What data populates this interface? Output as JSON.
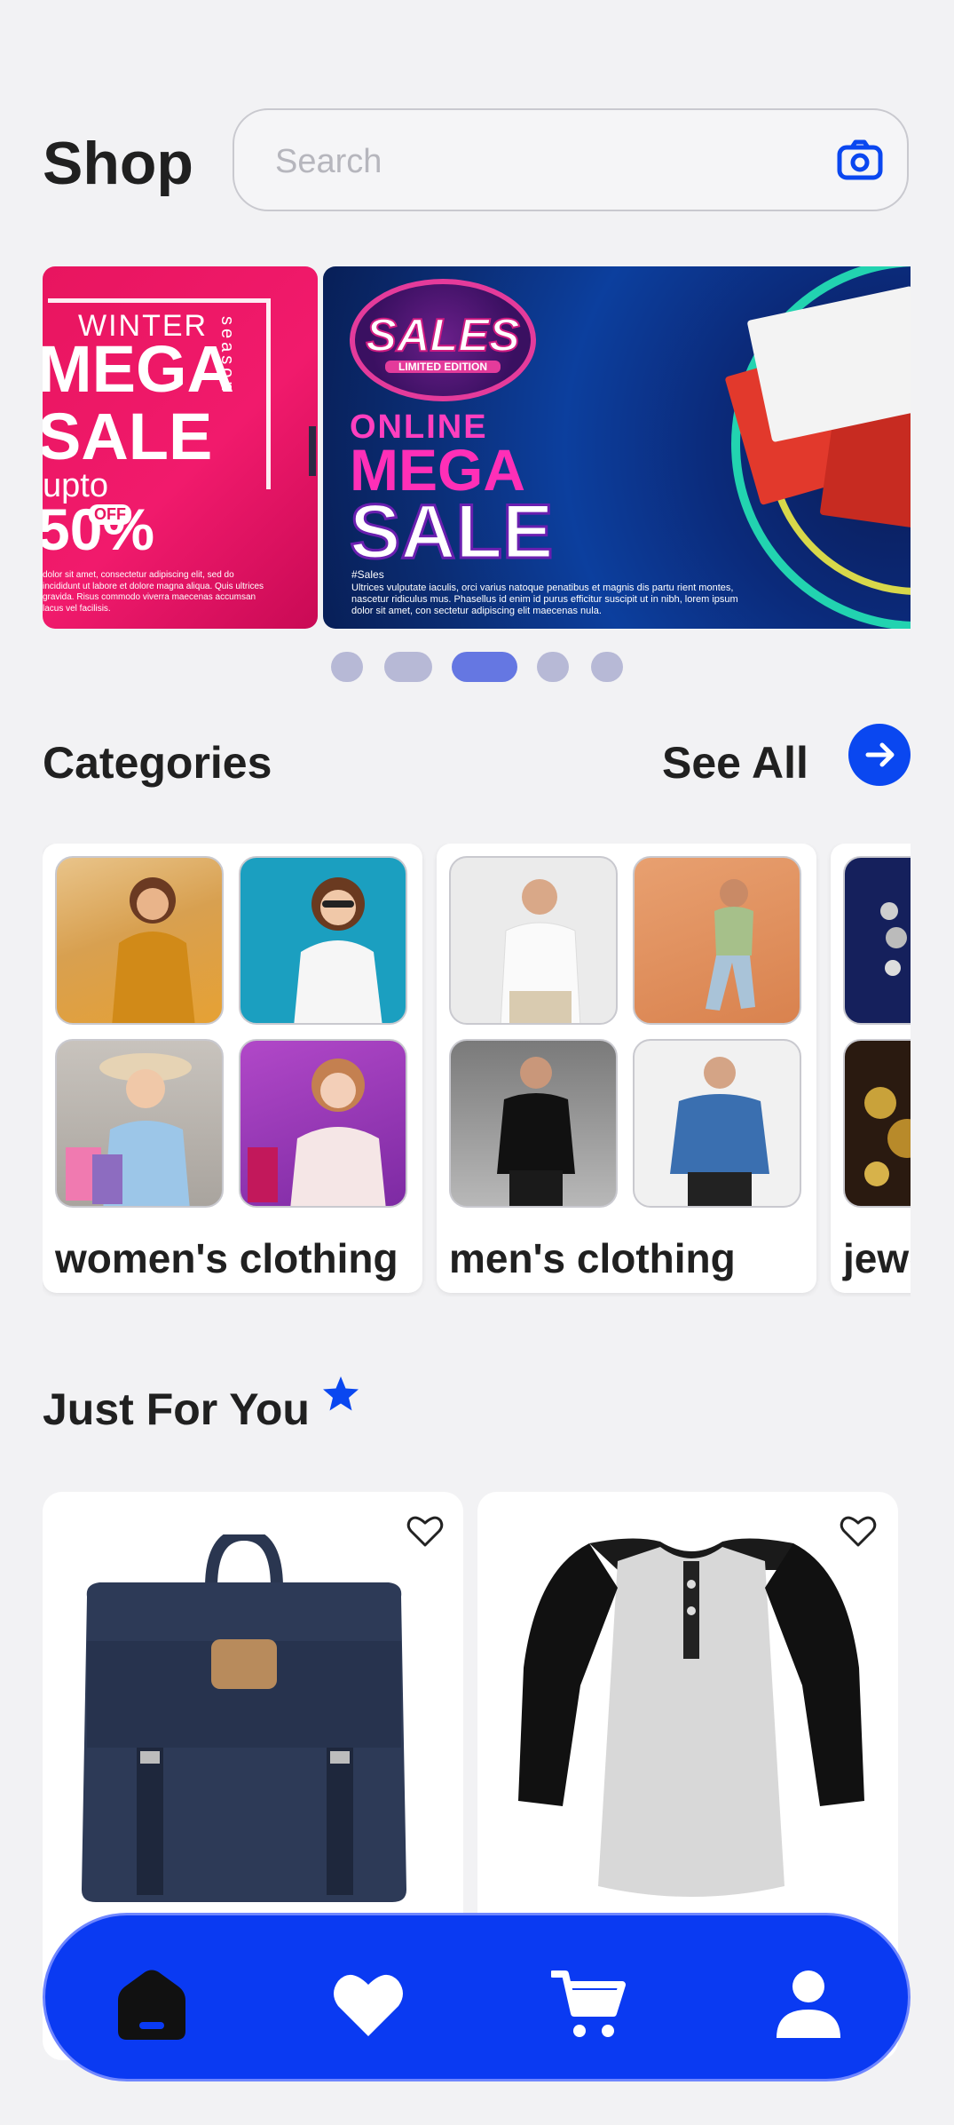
{
  "header": {
    "title": "Shop",
    "search_placeholder": "Search",
    "camera_icon": "camera-icon"
  },
  "banners": [
    {
      "id": "winter",
      "season": "season",
      "line1": "WINTER",
      "line2": "MEGA",
      "line3": "SALE",
      "line4": "upto",
      "discount": "50%",
      "off": "OFF",
      "fine_print": "dolor sit amet, consectetur adipiscing elit, sed do incididunt ut labore et dolore magna aliqua. Quis ultrices gravida. Risus commodo viverra maecenas accumsan lacus vel facilisis."
    },
    {
      "id": "online",
      "badge": "SALES",
      "badge_sub": "LIMITED EDITION",
      "line1": "ONLINE",
      "line2": "MEGA",
      "line3": "SALE",
      "hashtag": "#Sales",
      "fine_print": "Ultrices vulputate iaculis, orci varius natoque penatibus et magnis dis partu rient montes, nascetur ridiculus mus. Phasellus id enim id purus efficitur suscipit ut in nibh, lorem ipsum dolor sit amet, con sectetur adipiscing elit maecenas nula."
    }
  ],
  "carousel": {
    "dot_count": 5,
    "active_index": 2
  },
  "categories": {
    "title": "Categories",
    "see_all": "See All",
    "items": [
      {
        "label": "women's clothing"
      },
      {
        "label": "men's clothing"
      },
      {
        "label": "jewelery"
      }
    ]
  },
  "just_for_you": {
    "title": "Just For You",
    "products": [
      {
        "name": "navy backpack"
      },
      {
        "name": "raglan henley shirt"
      }
    ]
  },
  "colors": {
    "accent": "#0a3af2",
    "background": "#f2f2f4",
    "dot_active": "#6577e2",
    "dot_inactive": "#b7b9d6"
  },
  "nav": {
    "items": [
      {
        "name": "home",
        "icon": "home-icon"
      },
      {
        "name": "wishlist",
        "icon": "heart-icon"
      },
      {
        "name": "cart",
        "icon": "cart-icon"
      },
      {
        "name": "profile",
        "icon": "user-icon"
      }
    ]
  }
}
